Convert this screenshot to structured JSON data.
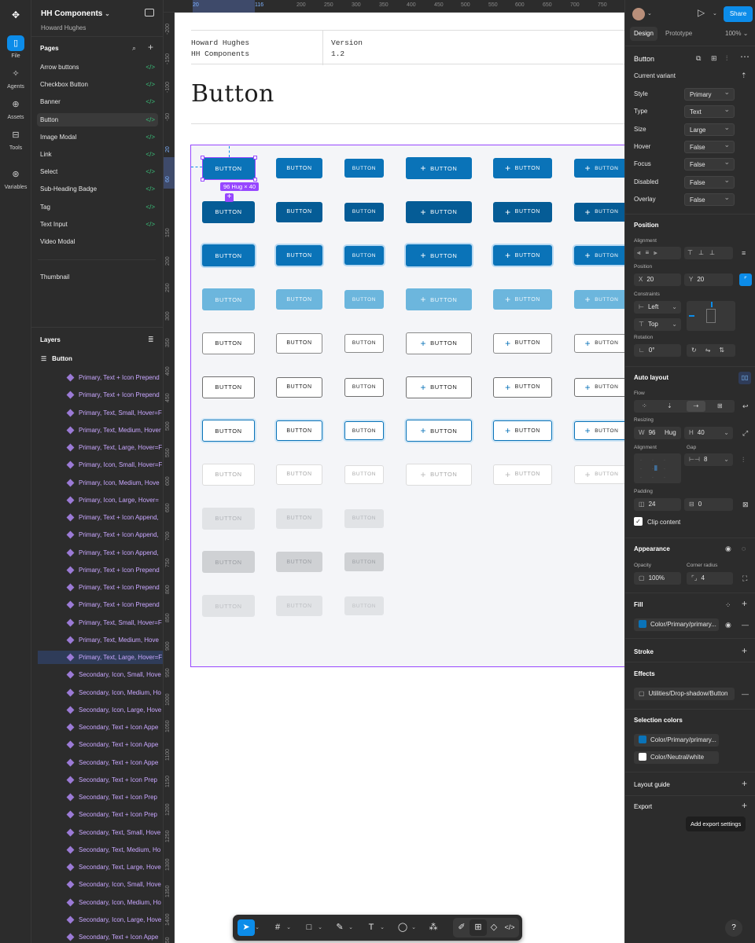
{
  "rail": {
    "items": [
      {
        "label": "File",
        "icon": "file-icon"
      },
      {
        "label": "Agents",
        "icon": "sparkle-icon"
      },
      {
        "label": "Assets",
        "icon": "assets-icon"
      },
      {
        "label": "Tools",
        "icon": "tools-icon"
      },
      {
        "label": "Variables",
        "icon": "variables-icon"
      }
    ]
  },
  "left_panel": {
    "file_name": "HH Components",
    "team": "Howard Hughes",
    "pages_header": "Pages",
    "pages": [
      {
        "label": "Arrow buttons"
      },
      {
        "label": "Checkbox Button"
      },
      {
        "label": "Banner"
      },
      {
        "label": "Button",
        "selected": true
      },
      {
        "label": "Image Modal"
      },
      {
        "label": "Link"
      },
      {
        "label": "Select"
      },
      {
        "label": "Sub-Heading Badge"
      },
      {
        "label": "Tag"
      },
      {
        "label": "Text Input"
      },
      {
        "label": "Video Modal"
      }
    ],
    "extra_page": "Thumbnail",
    "layers_header": "Layers",
    "layer_root": "Button",
    "layers": [
      "Primary, Text + Icon Prepend",
      "Primary, Text + Icon Prepend",
      "Primary, Text, Small, Hover=F",
      "Primary, Text, Medium, Hover",
      "Primary, Text, Large, Hover=F",
      "Primary, Icon, Small, Hover=F",
      "Primary, Icon, Medium, Hove",
      "Primary, Icon, Large, Hover=",
      "Primary, Text + Icon Append,",
      "Primary, Text + Icon Append,",
      "Primary, Text + Icon Append,",
      "Primary, Text + Icon Prepend",
      "Primary, Text + Icon Prepend",
      "Primary, Text + Icon Prepend",
      "Primary, Text, Small, Hover=F",
      "Primary, Text, Medium, Hove",
      "Primary, Text, Large, Hover=F",
      "Secondary, Icon, Small, Hove",
      "Secondary, Icon, Medium, Ho",
      "Secondary, Icon, Large, Hove",
      "Secondary, Text + Icon Appe",
      "Secondary, Text + Icon Appe",
      "Secondary, Text + Icon Appe",
      "Secondary, Text + Icon Prep",
      "Secondary, Text + Icon Prep",
      "Secondary, Text + Icon Prep",
      "Secondary, Text, Small, Hove",
      "Secondary, Text, Medium, Ho",
      "Secondary, Text, Large, Hove",
      "Secondary, Icon, Small, Hove",
      "Secondary, Icon, Medium, Ho",
      "Secondary, Icon, Large, Hove",
      "Secondary, Text + Icon Appe"
    ],
    "selected_layer_index": 16
  },
  "rulers": {
    "top": [
      "20",
      "116",
      "200",
      "250",
      "300",
      "350",
      "400",
      "450",
      "500",
      "550",
      "600",
      "650",
      "700",
      "750"
    ],
    "left": [
      "-200",
      "-150",
      "-100",
      "-50",
      "20",
      "60",
      "150",
      "200",
      "250",
      "300",
      "350",
      "400",
      "450",
      "500",
      "550",
      "600",
      "650",
      "700",
      "750",
      "800",
      "850",
      "900",
      "950",
      "1000",
      "1050",
      "1100",
      "1150",
      "1200",
      "1250",
      "1300",
      "1350",
      "1400",
      "1450"
    ]
  },
  "doc": {
    "author_line1": "Howard Hughes",
    "author_line2": "HH Components",
    "version_label": "Version",
    "version_value": "1.2",
    "title": "Button",
    "button_label": "BUTTON",
    "size_tag": "96 Hug × 40"
  },
  "right_panel": {
    "tabs": [
      "Design",
      "Prototype"
    ],
    "zoom": "100%",
    "share": "Share",
    "component_name": "Button",
    "current_variant": "Current variant",
    "props": [
      {
        "label": "Style",
        "value": "Primary"
      },
      {
        "label": "Type",
        "value": "Text"
      },
      {
        "label": "Size",
        "value": "Large"
      },
      {
        "label": "Hover",
        "value": "False"
      },
      {
        "label": "Focus",
        "value": "False"
      },
      {
        "label": "Disabled",
        "value": "False"
      },
      {
        "label": "Overlay",
        "value": "False"
      }
    ],
    "position": {
      "header": "Position",
      "alignment": "Alignment",
      "position_label": "Position",
      "x_label": "X",
      "x": "20",
      "y_label": "Y",
      "y": "20",
      "constraints": "Constraints",
      "h_constraint": "Left",
      "v_constraint": "Top",
      "rotation": "Rotation",
      "rotation_value": "0°"
    },
    "auto_layout": {
      "header": "Auto layout",
      "flow": "Flow",
      "resizing": "Resizing",
      "w_label": "W",
      "w": "96",
      "w_mode": "Hug",
      "h_label": "H",
      "h": "40",
      "alignment": "Alignment",
      "gap": "Gap",
      "gap_value": "8",
      "padding": "Padding",
      "pad_h": "24",
      "pad_v": "0",
      "clip": "Clip content"
    },
    "appearance": {
      "header": "Appearance",
      "opacity": "Opacity",
      "opacity_value": "100%",
      "radius": "Corner radius",
      "radius_value": "4"
    },
    "fill": {
      "header": "Fill",
      "value": "Color/Primary/primary...",
      "color": "#0a73b8"
    },
    "stroke": "Stroke",
    "effects": {
      "header": "Effects",
      "value": "Utilities/Drop-shadow/Button"
    },
    "selection_colors": {
      "header": "Selection colors",
      "items": [
        {
          "label": "Color/Primary/primary...",
          "color": "#0a73b8"
        },
        {
          "label": "Color/Neutral/white",
          "color": "#ffffff"
        }
      ]
    },
    "layout_guide": "Layout guide",
    "export": "Export",
    "export_tooltip": "Add export settings"
  },
  "colors": {
    "accent": "#0c8ce9",
    "selection": "#9747ff",
    "primary": "#0a73b8"
  }
}
